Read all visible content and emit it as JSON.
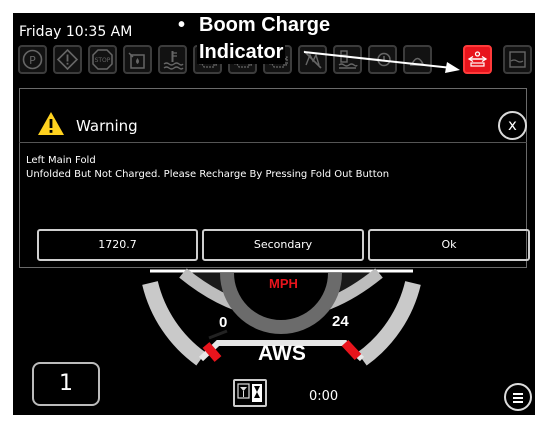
{
  "status": {
    "datetime": "Friday 10:35 AM"
  },
  "callout": {
    "bullet": "•",
    "line1": "Boom Charge",
    "line2": "Indicator"
  },
  "icons": [
    {
      "name": "parking-brake-icon"
    },
    {
      "name": "warning-icon"
    },
    {
      "name": "stop-icon",
      "text": "STOP"
    },
    {
      "name": "fuel-filter-icon"
    },
    {
      "name": "coolant-temp-icon"
    },
    {
      "name": "engine-icon"
    },
    {
      "name": "engine-alt-icon"
    },
    {
      "name": "regen-inhibit-icon"
    },
    {
      "name": "hydraulic-oil-icon"
    },
    {
      "name": "transmission-icon"
    },
    {
      "name": "glow-plug-icon"
    },
    {
      "name": "boom-charge-icon"
    },
    {
      "name": "tank-icon"
    }
  ],
  "colors": {
    "boom_charge_active": "#e8141c",
    "warning": "#ffd21f",
    "gauge_red": "#e8141c"
  },
  "dialog": {
    "title": "Warning",
    "close_label": "x",
    "message_line1": "Left Main Fold",
    "message_line2": "Unfolded But Not Charged.  Please Recharge By Pressing Fold Out Button",
    "buttons": [
      "1720.7",
      "Secondary",
      "Ok"
    ]
  },
  "gauge": {
    "unit": "MPH",
    "min_label": "0",
    "max_label": "24",
    "mode": "AWS"
  },
  "footer": {
    "gear": "1",
    "time": "0:00"
  }
}
